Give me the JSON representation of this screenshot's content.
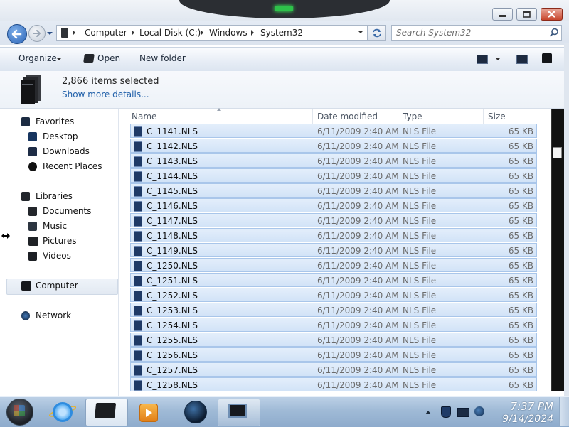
{
  "window": {
    "breadcrumbs": [
      "Computer",
      "Local Disk (C:)",
      "Windows",
      "System32"
    ]
  },
  "search": {
    "placeholder": "Search System32"
  },
  "toolbar": {
    "organize_label": "Organize",
    "open_label": "Open",
    "new_folder_label": "New folder"
  },
  "details": {
    "selection_count": "2,866 items selected",
    "show_more_label": "Show more details..."
  },
  "nav": {
    "favorites": {
      "label": "Favorites",
      "items": [
        "Desktop",
        "Downloads",
        "Recent Places"
      ]
    },
    "libraries": {
      "label": "Libraries",
      "items": [
        "Documents",
        "Music",
        "Pictures",
        "Videos"
      ]
    },
    "computer": {
      "label": "Computer"
    },
    "network": {
      "label": "Network"
    }
  },
  "columns": {
    "name": "Name",
    "date": "Date modified",
    "type": "Type",
    "size": "Size"
  },
  "files": [
    {
      "name": "C_1141.NLS",
      "date": "6/11/2009 2:40 AM",
      "type": "NLS File",
      "size": "65 KB"
    },
    {
      "name": "C_1142.NLS",
      "date": "6/11/2009 2:40 AM",
      "type": "NLS File",
      "size": "65 KB"
    },
    {
      "name": "C_1143.NLS",
      "date": "6/11/2009 2:40 AM",
      "type": "NLS File",
      "size": "65 KB"
    },
    {
      "name": "C_1144.NLS",
      "date": "6/11/2009 2:40 AM",
      "type": "NLS File",
      "size": "65 KB"
    },
    {
      "name": "C_1145.NLS",
      "date": "6/11/2009 2:40 AM",
      "type": "NLS File",
      "size": "65 KB"
    },
    {
      "name": "C_1146.NLS",
      "date": "6/11/2009 2:40 AM",
      "type": "NLS File",
      "size": "65 KB"
    },
    {
      "name": "C_1147.NLS",
      "date": "6/11/2009 2:40 AM",
      "type": "NLS File",
      "size": "65 KB"
    },
    {
      "name": "C_1148.NLS",
      "date": "6/11/2009 2:40 AM",
      "type": "NLS File",
      "size": "65 KB"
    },
    {
      "name": "C_1149.NLS",
      "date": "6/11/2009 2:40 AM",
      "type": "NLS File",
      "size": "65 KB"
    },
    {
      "name": "C_1250.NLS",
      "date": "6/11/2009 2:40 AM",
      "type": "NLS File",
      "size": "65 KB"
    },
    {
      "name": "C_1251.NLS",
      "date": "6/11/2009 2:40 AM",
      "type": "NLS File",
      "size": "65 KB"
    },
    {
      "name": "C_1252.NLS",
      "date": "6/11/2009 2:40 AM",
      "type": "NLS File",
      "size": "65 KB"
    },
    {
      "name": "C_1253.NLS",
      "date": "6/11/2009 2:40 AM",
      "type": "NLS File",
      "size": "65 KB"
    },
    {
      "name": "C_1254.NLS",
      "date": "6/11/2009 2:40 AM",
      "type": "NLS File",
      "size": "65 KB"
    },
    {
      "name": "C_1255.NLS",
      "date": "6/11/2009 2:40 AM",
      "type": "NLS File",
      "size": "65 KB"
    },
    {
      "name": "C_1256.NLS",
      "date": "6/11/2009 2:40 AM",
      "type": "NLS File",
      "size": "65 KB"
    },
    {
      "name": "C_1257.NLS",
      "date": "6/11/2009 2:40 AM",
      "type": "NLS File",
      "size": "65 KB"
    },
    {
      "name": "C_1258.NLS",
      "date": "6/11/2009 2:40 AM",
      "type": "NLS File",
      "size": "65 KB"
    }
  ],
  "taskbar": {
    "time": "7:37 PM",
    "date": "9/14/2024"
  },
  "icons": {
    "back": "back-arrow-icon",
    "forward": "forward-arrow-icon",
    "search": "search-icon",
    "refresh": "refresh-icon",
    "file": "nls-file-icon"
  },
  "colors": {
    "selection_fill": "#d6e6f8",
    "selection_border": "#a9c6ea",
    "link": "#1f5fa9",
    "close_button": "#c8462d",
    "taskbar": "#9fbad6"
  }
}
